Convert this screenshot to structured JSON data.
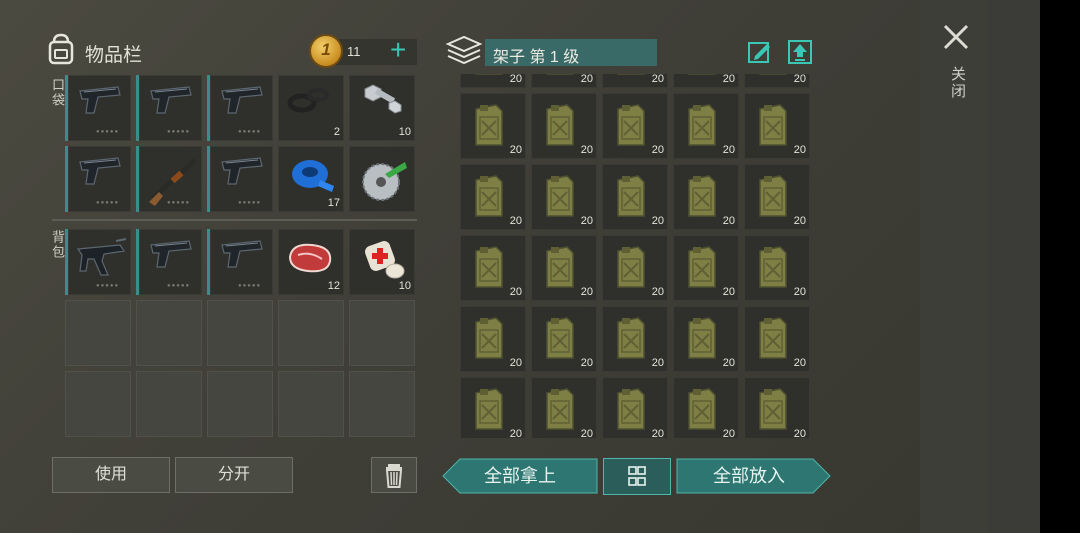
{
  "inventory": {
    "title": "物品栏",
    "coins": "11",
    "add_symbol": "+",
    "pocket_label": "口袋",
    "backpack_label": "背包",
    "pocket_items": [
      {
        "icon": "pistol-icon",
        "qty": ""
      },
      {
        "icon": "pistol-icon",
        "qty": ""
      },
      {
        "icon": "pistol-icon",
        "qty": ""
      },
      {
        "icon": "rubber-rings-icon",
        "qty": "2"
      },
      {
        "icon": "bolt-nut-icon",
        "qty": "10"
      },
      {
        "icon": "pistol-icon",
        "qty": ""
      },
      {
        "icon": "shotgun-icon",
        "qty": ""
      },
      {
        "icon": "pistol-icon",
        "qty": ""
      },
      {
        "icon": "duct-tape-icon",
        "qty": "17"
      },
      {
        "icon": "saw-blade-icon",
        "qty": ""
      }
    ],
    "backpack_items": [
      {
        "icon": "smg-icon",
        "qty": ""
      },
      {
        "icon": "pistol-icon",
        "qty": ""
      },
      {
        "icon": "pistol-icon",
        "qty": ""
      },
      {
        "icon": "raw-meat-icon",
        "qty": "12"
      },
      {
        "icon": "bandage-icon",
        "qty": "10"
      }
    ],
    "use_label": "使用",
    "split_label": "分开"
  },
  "shelf": {
    "title": "架子 第 1 级",
    "item_icon": "jerry-can-icon",
    "item_qty": "20",
    "take_all_label": "全部拿上",
    "put_all_label": "全部放入"
  },
  "close_label": "关闭",
  "colors": {
    "accent": "#3bc7b5",
    "teal_button": "#2f7b76",
    "slot": "#2f302c"
  }
}
